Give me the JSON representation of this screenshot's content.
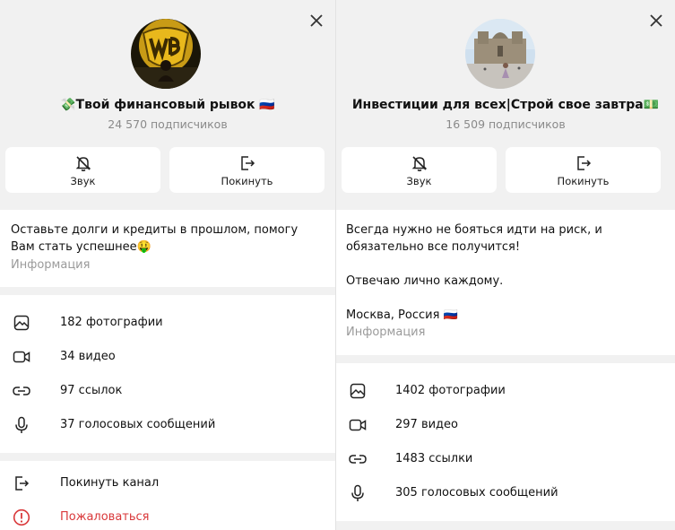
{
  "left": {
    "title": "💸Твой финансовый рывок 🇷🇺",
    "subscribers": "24 570 подписчиков",
    "actions": [
      {
        "label": "Звук",
        "icon": "bell-off-icon"
      },
      {
        "label": "Покинуть",
        "icon": "leave-icon"
      }
    ],
    "description": "Оставьте долги и кредиты в прошлом, помогу Вам стать успешнее🤑",
    "description_label": "Информация",
    "media": [
      {
        "label": "182 фотографии",
        "icon": "photo-icon"
      },
      {
        "label": "34 видео",
        "icon": "video-icon"
      },
      {
        "label": "97 ссылок",
        "icon": "link-icon"
      },
      {
        "label": "37 голосовых сообщений",
        "icon": "microphone-icon"
      }
    ],
    "bottom_actions": [
      {
        "label": "Покинуть канал",
        "icon": "leave-icon"
      },
      {
        "label": "Пожаловаться",
        "icon": "report-icon"
      }
    ]
  },
  "right": {
    "title": "Инвестиции для всех|Строй свое завтра💵",
    "subscribers": "16 509 подписчиков",
    "actions": [
      {
        "label": "Звук",
        "icon": "bell-off-icon"
      },
      {
        "label": "Покинуть",
        "icon": "leave-icon"
      }
    ],
    "description_lines": [
      "Всегда нужно не бояться идти на риск, и обязательно все получится!",
      "Отвечаю лично каждому.",
      "Москва, Россия 🇷🇺"
    ],
    "description_label": "Информация",
    "media": [
      {
        "label": "1402 фотографии",
        "icon": "photo-icon"
      },
      {
        "label": "297 видео",
        "icon": "video-icon"
      },
      {
        "label": "1483 ссылки",
        "icon": "link-icon"
      },
      {
        "label": "305 голосовых сообщений",
        "icon": "microphone-icon"
      }
    ]
  },
  "colors": {
    "background": "#f1f1f1",
    "card": "#ffffff",
    "muted": "#8a8a8a",
    "danger": "#d9383a"
  }
}
